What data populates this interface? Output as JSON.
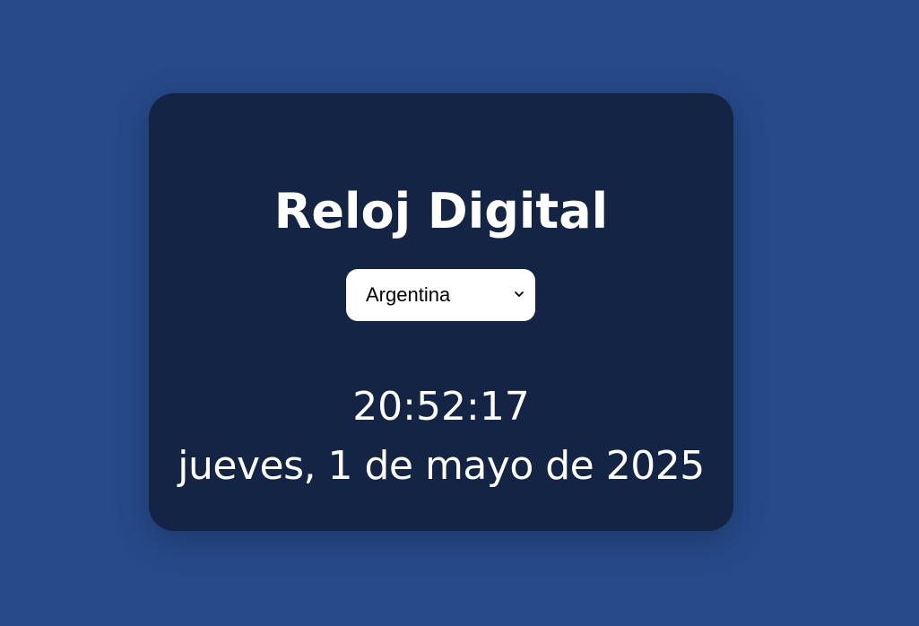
{
  "clock": {
    "title": "Reloj Digital",
    "country_select": {
      "selected": "Argentina",
      "arrow_icon": "chevron-down-icon"
    },
    "time": "20:52:17",
    "date": "jueves, 1 de mayo de 2025"
  },
  "colors": {
    "background": "#264a8a",
    "card": "#132445",
    "text": "#ffffff"
  }
}
